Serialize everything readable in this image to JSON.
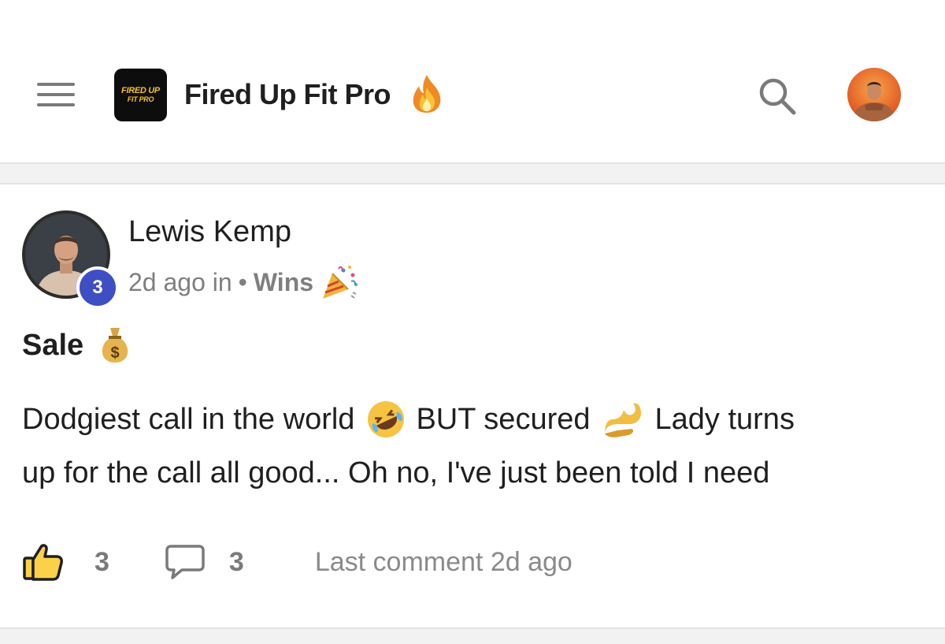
{
  "header": {
    "menu_icon": "hamburger-menu-icon",
    "logo_text_line1": "FIRED UP",
    "logo_text_line2": "FIT PRO",
    "title": "Fired Up Fit Pro",
    "title_emoji": "fire-icon",
    "search_icon": "search-icon",
    "avatar_icon": "user-avatar"
  },
  "post": {
    "author": {
      "name": "Lewis Kemp",
      "level": "3"
    },
    "meta": {
      "time": "2d ago in",
      "separator": "•",
      "category": "Wins",
      "category_emoji": "party-popper-icon"
    },
    "title": "Sale",
    "title_emoji": "money-bag-icon",
    "body": {
      "line1_part1": "Dodgiest call in the world",
      "line1_part2": "BUT secured",
      "line1_part3": "Lady turns",
      "line2": "up for the call all good... Oh no, I've just been told I need"
    },
    "actions": {
      "like_count": "3",
      "comment_count": "3",
      "last_comment": "Last comment 2d ago"
    }
  },
  "colors": {
    "level_badge": "#3e4fc4",
    "muted_text": "#7f7f7f",
    "divider": "#f2f2f2"
  }
}
